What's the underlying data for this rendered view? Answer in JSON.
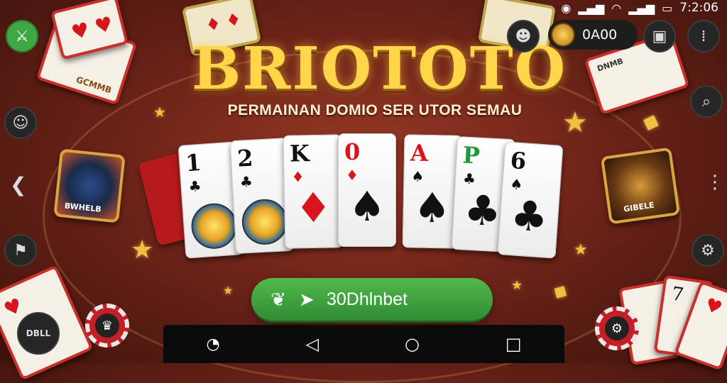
{
  "status_bar": {
    "time": "7:2:06"
  },
  "header": {
    "title": "BRIOTOTO",
    "subtitle": "PERMAINAN DOMIO SER UTOR SEMAU"
  },
  "balance": {
    "amount": "0A00"
  },
  "hand": [
    {
      "rank": "1",
      "suit": "♣",
      "suit_color": "black",
      "center": "medal"
    },
    {
      "rank": "2",
      "suit": "♣",
      "suit_color": "black",
      "center": "medal"
    },
    {
      "rank": "K",
      "suit": "♦",
      "suit_color": "black",
      "center": "♦"
    },
    {
      "rank": "0",
      "suit": "♦",
      "suit_color": "red",
      "center": "♠"
    },
    {
      "rank": "A",
      "suit": "♠",
      "suit_color": "red",
      "center": "♠"
    },
    {
      "rank": "P",
      "suit": "♣",
      "suit_color": "green",
      "center": "♣"
    },
    {
      "rank": "6",
      "suit": "♠",
      "suit_color": "black",
      "center": "♣"
    }
  ],
  "cta": {
    "label": "30Dhlnbet"
  },
  "left_chip": {
    "label": "DBLL"
  },
  "deco": {
    "left_card_label": "GCMMB",
    "right_card_label": "GIBELE",
    "left_pic_label": "BWHELB",
    "right_top_label": "DNMB"
  },
  "icons": {
    "top_left": "sword-icon",
    "left_1": "emoji-icon",
    "left_2": "chevron-left-icon",
    "left_3": "flag-icon",
    "right_1": "search-icon",
    "right_2": "more-icon",
    "right_3": "settings-icon",
    "top_right_1": "profile-icon",
    "top_right_2": "chat-icon",
    "top_right_3": "menu-icon"
  },
  "colors": {
    "cta": "#3fa744",
    "title": "#ffd54a",
    "table": "#6e2418"
  }
}
